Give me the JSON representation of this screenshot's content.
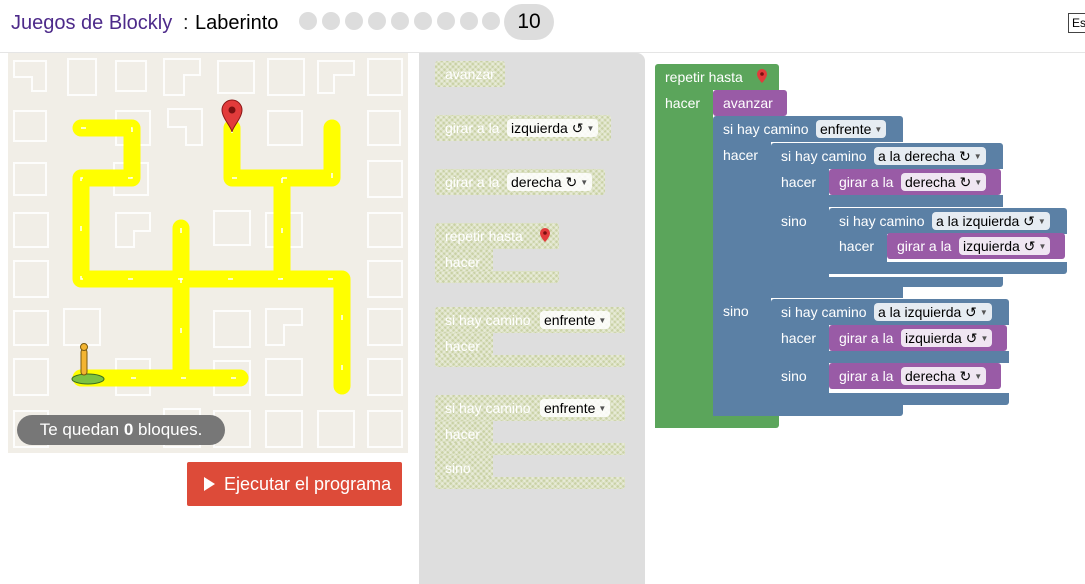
{
  "header": {
    "app_name": "Juegos de Blockly",
    "separator": ":",
    "level_name": "Laberinto",
    "current_level": "10",
    "language_label": "Es"
  },
  "maze": {
    "blocks_left_prefix": "Te quedan ",
    "blocks_left_count": "0",
    "blocks_left_suffix": " bloques.",
    "run_button": "Ejecutar el programa"
  },
  "toolbox": {
    "move_forward": "avanzar",
    "turn_label": "girar a la",
    "turn_left_value": "izquierda ↺",
    "turn_right_value": "derecha ↻",
    "repeat_until": "repetir hasta",
    "do_label": "hacer",
    "if_path": "si hay camino",
    "ahead_value": "enfrente",
    "else_label": "sino"
  },
  "workspace": {
    "repeat_until": "repetir hasta",
    "do_label": "hacer",
    "move_forward": "avanzar",
    "if_path": "si hay camino",
    "ahead_value": "enfrente",
    "right_dir_value": "a la derecha ↻",
    "left_dir_value": "a la izquierda ↺",
    "turn_label": "girar a la",
    "turn_right_value": "derecha ↻",
    "turn_left_value": "izquierda ↺",
    "else_label": "sino"
  },
  "colors": {
    "loop_block": "#5ba55b",
    "movement_block": "#995ba6",
    "logic_block": "#5b80a5",
    "run_button": "#dd4b39",
    "path": "#ffff00",
    "app_name": "#4d2a8a"
  },
  "icons": [
    "map-pin-icon",
    "pegman-icon",
    "play-icon",
    "dropdown-arrow-icon"
  ]
}
